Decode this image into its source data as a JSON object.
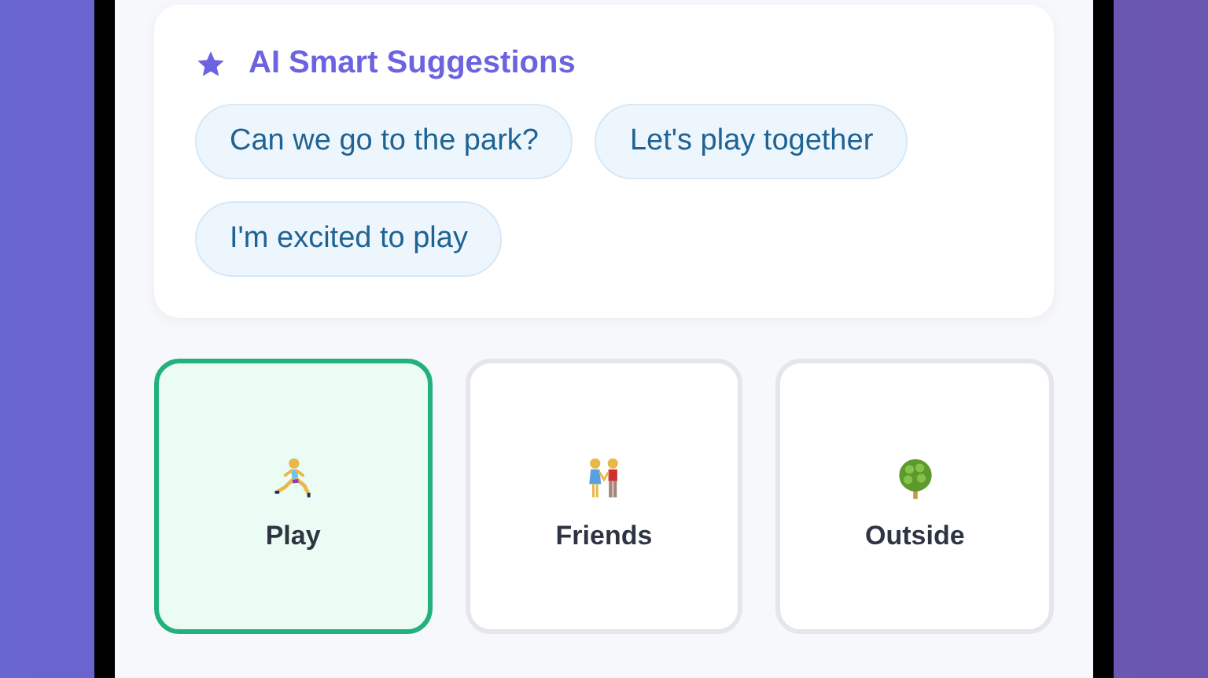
{
  "suggestions": {
    "title": "AI Smart Suggestions",
    "chips": [
      "Can we go to the park?",
      "Let's play together",
      "I'm excited to play"
    ]
  },
  "tiles": [
    {
      "kind": "running",
      "label": "Play",
      "selected": true
    },
    {
      "kind": "couple",
      "label": "Friends",
      "selected": false
    },
    {
      "kind": "tree",
      "label": "Outside",
      "selected": false
    }
  ]
}
